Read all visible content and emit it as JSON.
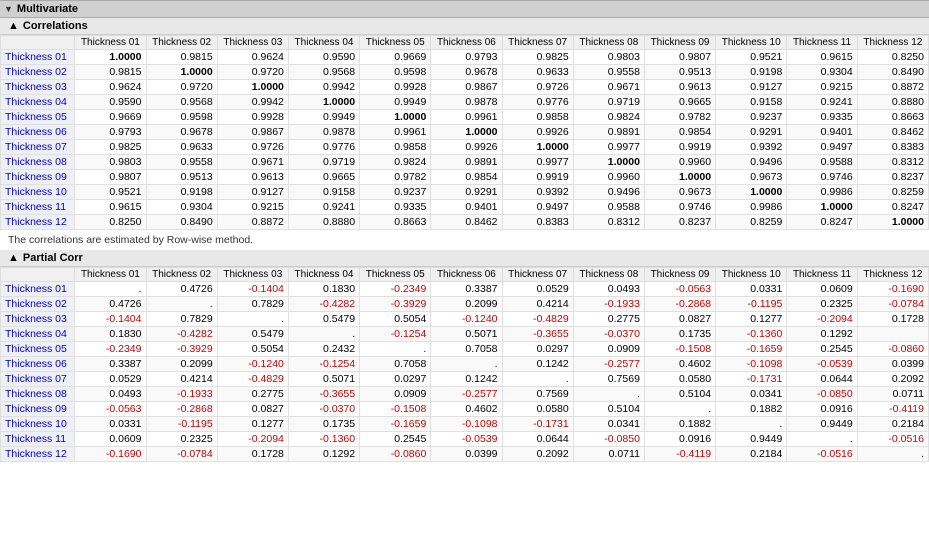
{
  "multivariate": {
    "title": "Multivariate",
    "correlations": {
      "title": "Correlations",
      "note": "The correlations are estimated by Row-wise method.",
      "columns": [
        "",
        "Thickness 01",
        "Thickness 02",
        "Thickness 03",
        "Thickness 04",
        "Thickness 05",
        "Thickness 06",
        "Thickness 07",
        "Thickness 08",
        "Thickness 09",
        "Thickness 10",
        "Thickness 11",
        "Thickness 12"
      ],
      "rows": [
        {
          "label": "Thickness 01",
          "values": [
            "1.0000",
            "0.9815",
            "0.9624",
            "0.9590",
            "0.9669",
            "0.9793",
            "0.9825",
            "0.9803",
            "0.9807",
            "0.9521",
            "0.9615",
            "0.8250"
          ]
        },
        {
          "label": "Thickness 02",
          "values": [
            "0.9815",
            "1.0000",
            "0.9720",
            "0.9568",
            "0.9598",
            "0.9678",
            "0.9633",
            "0.9558",
            "0.9513",
            "0.9198",
            "0.9304",
            "0.8490"
          ]
        },
        {
          "label": "Thickness 03",
          "values": [
            "0.9624",
            "0.9720",
            "1.0000",
            "0.9942",
            "0.9928",
            "0.9867",
            "0.9726",
            "0.9671",
            "0.9613",
            "0.9127",
            "0.9215",
            "0.8872"
          ]
        },
        {
          "label": "Thickness 04",
          "values": [
            "0.9590",
            "0.9568",
            "0.9942",
            "1.0000",
            "0.9949",
            "0.9878",
            "0.9776",
            "0.9719",
            "0.9665",
            "0.9158",
            "0.9241",
            "0.8880"
          ]
        },
        {
          "label": "Thickness 05",
          "values": [
            "0.9669",
            "0.9598",
            "0.9928",
            "0.9949",
            "1.0000",
            "0.9961",
            "0.9858",
            "0.9824",
            "0.9782",
            "0.9237",
            "0.9335",
            "0.8663"
          ]
        },
        {
          "label": "Thickness 06",
          "values": [
            "0.9793",
            "0.9678",
            "0.9867",
            "0.9878",
            "0.9961",
            "1.0000",
            "0.9926",
            "0.9891",
            "0.9854",
            "0.9291",
            "0.9401",
            "0.8462"
          ]
        },
        {
          "label": "Thickness 07",
          "values": [
            "0.9825",
            "0.9633",
            "0.9726",
            "0.9776",
            "0.9858",
            "0.9926",
            "1.0000",
            "0.9977",
            "0.9919",
            "0.9392",
            "0.9497",
            "0.8383"
          ]
        },
        {
          "label": "Thickness 08",
          "values": [
            "0.9803",
            "0.9558",
            "0.9671",
            "0.9719",
            "0.9824",
            "0.9891",
            "0.9977",
            "1.0000",
            "0.9960",
            "0.9496",
            "0.9588",
            "0.8312"
          ]
        },
        {
          "label": "Thickness 09",
          "values": [
            "0.9807",
            "0.9513",
            "0.9613",
            "0.9665",
            "0.9782",
            "0.9854",
            "0.9919",
            "0.9960",
            "1.0000",
            "0.9673",
            "0.9746",
            "0.8237"
          ]
        },
        {
          "label": "Thickness 10",
          "values": [
            "0.9521",
            "0.9198",
            "0.9127",
            "0.9158",
            "0.9237",
            "0.9291",
            "0.9392",
            "0.9496",
            "0.9673",
            "1.0000",
            "0.9986",
            "0.8259"
          ]
        },
        {
          "label": "Thickness 11",
          "values": [
            "0.9615",
            "0.9304",
            "0.9215",
            "0.9241",
            "0.9335",
            "0.9401",
            "0.9497",
            "0.9588",
            "0.9746",
            "0.9986",
            "1.0000",
            "0.8247"
          ]
        },
        {
          "label": "Thickness 12",
          "values": [
            "0.8250",
            "0.8490",
            "0.8872",
            "0.8880",
            "0.8663",
            "0.8462",
            "0.8383",
            "0.8312",
            "0.8237",
            "0.8259",
            "0.8247",
            "1.0000"
          ]
        }
      ]
    },
    "partial_corr": {
      "title": "Partial Corr",
      "columns": [
        "",
        "Thickness 01",
        "Thickness 02",
        "Thickness 03",
        "Thickness 04",
        "Thickness 05",
        "Thickness 06",
        "Thickness 07",
        "Thickness 08",
        "Thickness 09",
        "Thickness 10",
        "Thickness 11",
        "Thickness 12"
      ],
      "rows": [
        {
          "label": "Thickness 01",
          "values": [
            ".",
            "0.4726",
            "-0.1404",
            "0.1830",
            "-0.2349",
            "0.3387",
            "0.0529",
            "0.0493",
            "-0.0563",
            "0.0331",
            "0.0609",
            "-0.1690"
          ]
        },
        {
          "label": "Thickness 02",
          "values": [
            "0.4726",
            ".",
            "0.7829",
            "-0.4282",
            "-0.3929",
            "0.2099",
            "0.4214",
            "-0.1933",
            "-0.2868",
            "-0.1195",
            "0.2325",
            "-0.0784"
          ]
        },
        {
          "label": "Thickness 03",
          "values": [
            "-0.1404",
            "0.7829",
            ".",
            "0.5479",
            "0.5054",
            "-0.1240",
            "-0.4829",
            "0.2775",
            "0.0827",
            "0.1277",
            "-0.2094",
            "0.1728"
          ]
        },
        {
          "label": "Thickness 04",
          "values": [
            "0.1830",
            "-0.4282",
            "0.5479",
            ".",
            "-0.1254",
            "0.5071",
            "-0.3655",
            "-0.0370",
            "0.1735",
            "-0.1360",
            "0.1292",
            ""
          ]
        },
        {
          "label": "Thickness 05",
          "values": [
            "-0.2349",
            "-0.3929",
            "0.5054",
            "0.2432",
            ".",
            "0.7058",
            "0.0297",
            "0.0909",
            "-0.1508",
            "-0.1659",
            "0.2545",
            "-0.0860"
          ]
        },
        {
          "label": "Thickness 06",
          "values": [
            "0.3387",
            "0.2099",
            "-0.1240",
            "-0.1254",
            "0.7058",
            ".",
            "0.1242",
            "-0.2577",
            "0.4602",
            "-0.1098",
            "-0.0539",
            "0.0399"
          ]
        },
        {
          "label": "Thickness 07",
          "values": [
            "0.0529",
            "0.4214",
            "-0.4829",
            "0.5071",
            "0.0297",
            "0.1242",
            ".",
            "0.7569",
            "0.0580",
            "-0.1731",
            "0.0644",
            "0.2092"
          ]
        },
        {
          "label": "Thickness 08",
          "values": [
            "0.0493",
            "-0.1933",
            "0.2775",
            "-0.3655",
            "0.0909",
            "-0.2577",
            "0.7569",
            ".",
            "0.5104",
            "0.0341",
            "-0.0850",
            "0.0711"
          ]
        },
        {
          "label": "Thickness 09",
          "values": [
            "-0.0563",
            "-0.2868",
            "0.0827",
            "-0.0370",
            "-0.1508",
            "0.4602",
            "0.0580",
            "0.5104",
            ".",
            "0.1882",
            "0.0916",
            "-0.4119"
          ]
        },
        {
          "label": "Thickness 10",
          "values": [
            "0.0331",
            "-0.1195",
            "0.1277",
            "0.1735",
            "-0.1659",
            "-0.1098",
            "-0.1731",
            "0.0341",
            "0.1882",
            ".",
            "0.9449",
            "0.2184"
          ]
        },
        {
          "label": "Thickness 11",
          "values": [
            "0.0609",
            "0.2325",
            "-0.2094",
            "-0.1360",
            "0.2545",
            "-0.0539",
            "0.0644",
            "-0.0850",
            "0.0916",
            "0.9449",
            ".",
            "-0.0516"
          ]
        },
        {
          "label": "Thickness 12",
          "values": [
            "-0.1690",
            "-0.0784",
            "0.1728",
            "0.1292",
            "-0.0860",
            "0.0399",
            "0.2092",
            "0.0711",
            "-0.4119",
            "0.2184",
            "-0.0516",
            "."
          ]
        }
      ]
    }
  }
}
